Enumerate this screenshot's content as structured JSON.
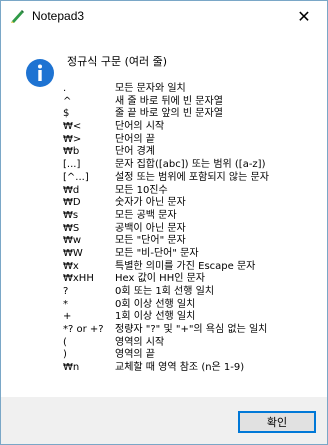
{
  "window": {
    "title": "Notepad3"
  },
  "dialog": {
    "heading": "정규식 구문 (여러 줄)",
    "button_ok": "확인"
  },
  "syntax_rows": [
    {
      "key": ".",
      "desc": "모든 문자와 일치"
    },
    {
      "key": "^",
      "desc": "새 줄 바로 뒤에 빈 문자열"
    },
    {
      "key": "$",
      "desc": "줄 끝 바로 앞의 빈 문자열"
    },
    {
      "key": "₩<",
      "desc": "단어의 시작"
    },
    {
      "key": "₩>",
      "desc": "단어의 끝"
    },
    {
      "key": "₩b",
      "desc": "단어 경계"
    },
    {
      "key": "[...]",
      "desc": "문자 집합([abc]) 또는 범위 ([a-z])"
    },
    {
      "key": "[^...]",
      "desc": "설정 또는 범위에 포함되지 않는 문자"
    },
    {
      "key": "₩d",
      "desc": "모든 10진수"
    },
    {
      "key": "₩D",
      "desc": "숫자가 아닌 문자"
    },
    {
      "key": "₩s",
      "desc": "모든 공백 문자"
    },
    {
      "key": "₩S",
      "desc": "공백이 아닌 문자"
    },
    {
      "key": "₩w",
      "desc": "모든 \"단어\" 문자"
    },
    {
      "key": "₩W",
      "desc": "모든 \"비-단어\" 문자"
    },
    {
      "key": "₩x",
      "desc": "특별한 의미를 가진 Escape 문자"
    },
    {
      "key": "₩xHH",
      "desc": "Hex 값이 HH인 문자"
    },
    {
      "key": "?",
      "desc": "0회 또는 1회 선행 일치"
    },
    {
      "key": "*",
      "desc": "0회 이상 선행 일치"
    },
    {
      "key": "+",
      "desc": "1회 이상 선행 일치"
    },
    {
      "key": "*? or +?",
      "desc": "정량자 \"?\" 및 \"+\"의 욕심 없는 일치"
    },
    {
      "key": "(",
      "desc": "영역의 시작"
    },
    {
      "key": ")",
      "desc": "영역의 끝"
    },
    {
      "key": "₩n",
      "desc": "교체할 때 영역 참조 (n은 1-9)"
    }
  ],
  "icons": {
    "app": "notepad3-icon",
    "info": "info-icon",
    "close": "close-icon"
  },
  "colors": {
    "info_blue": "#1e73d2",
    "accent": "#0078d7"
  }
}
